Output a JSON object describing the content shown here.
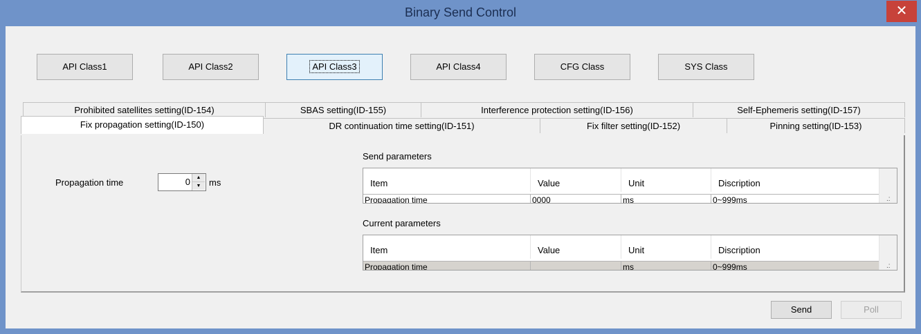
{
  "window": {
    "title": "Binary Send Control",
    "close_glyph": "✕"
  },
  "class_buttons": [
    "API Class1",
    "API Class2",
    "API Class3",
    "API Class4",
    "CFG Class",
    "SYS Class"
  ],
  "active_class": "API Class3",
  "tabs_row1": [
    "Prohibited satellites setting(ID-154)",
    "SBAS setting(ID-155)",
    "Interference protection setting(ID-156)",
    "Self-Ephemeris setting(ID-157)"
  ],
  "tabs_row2": [
    "Fix propagation setting(ID-150)",
    "DR continuation time setting(ID-151)",
    "Fix filter setting(ID-152)",
    "Pinning setting(ID-153)"
  ],
  "selected_tab": "Fix propagation setting(ID-150)",
  "propagation": {
    "label": "Propagation time",
    "value": "0",
    "unit": "ms"
  },
  "send_parameters": {
    "title": "Send parameters",
    "columns": [
      "Item",
      "Value",
      "Unit",
      "Discription"
    ],
    "row": [
      "Propagation time",
      "0000",
      "ms",
      "0~999ms"
    ]
  },
  "current_parameters": {
    "title": "Current parameters",
    "columns": [
      "Item",
      "Value",
      "Unit",
      "Discription"
    ],
    "row": [
      "Propagation time",
      "",
      "ms",
      "0~999ms"
    ]
  },
  "actions": {
    "send": "Send",
    "poll": "Poll"
  },
  "colors": {
    "titlebar": "#6f93c9",
    "close": "#c7423a",
    "active_button": "#e3f1fb",
    "row_highlight": "#d6d3ce"
  }
}
